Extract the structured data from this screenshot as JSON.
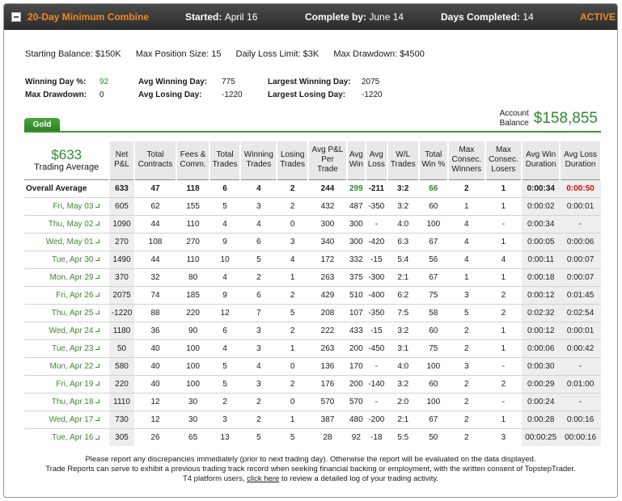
{
  "header": {
    "combine_name": "20-Day Minimum Combine",
    "started_label": "Started:",
    "started_value": "April 16",
    "complete_label": "Complete by:",
    "complete_value": "June 14",
    "days_label": "Days Completed:",
    "days_value": "14",
    "status": "ACTIVE"
  },
  "summary": {
    "starting_balance": "Starting Balance: $150K",
    "max_position": "Max Position Size: 15",
    "daily_loss": "Daily Loss Limit: $3K",
    "max_drawdown": "Max Drawdown: $4500"
  },
  "stats": {
    "winning_day_pct_label": "Winning Day %:",
    "winning_day_pct_value": "92",
    "max_drawdown_label": "Max Drawdown:",
    "max_drawdown_value": "0",
    "avg_winning_day_label": "Avg Winning Day:",
    "avg_winning_day_value": "775",
    "avg_losing_day_label": "Avg Losing Day:",
    "avg_losing_day_value": "-1220",
    "largest_winning_day_label": "Largest Winning Day:",
    "largest_winning_day_value": "2075",
    "largest_losing_day_label": "Largest Losing Day:",
    "largest_losing_day_value": "-1220"
  },
  "tab_label": "Gold",
  "account": {
    "label_line1": "Account",
    "label_line2": "Balance",
    "value": "$158,855"
  },
  "table": {
    "avg_trade_value": "$633",
    "avg_trade_label": "Trading Average",
    "headers": [
      [
        "Net",
        "P&L"
      ],
      [
        "Total",
        "Contracts"
      ],
      [
        "Fees &",
        "Comm."
      ],
      [
        "Total",
        "Trades"
      ],
      [
        "Winning",
        "Trades"
      ],
      [
        "Losing",
        "Trades"
      ],
      [
        "Avg P&L",
        "Per",
        "Trade"
      ],
      [
        "Avg",
        "Win"
      ],
      [
        "Avg",
        "Loss"
      ],
      [
        "W/L",
        "Trades"
      ],
      [
        "Total",
        "Win %"
      ],
      [
        "Max",
        "Consec.",
        "Winners"
      ],
      [
        "Max",
        "Consec.",
        "Losers"
      ],
      [
        "Avg Win",
        "Duration"
      ],
      [
        "Avg Loss",
        "Duration"
      ]
    ],
    "overall": [
      "Overall Average",
      "633",
      "47",
      "118",
      "6",
      "4",
      "2",
      "244",
      "299",
      "-211",
      "3:2",
      "66",
      "2",
      "1",
      "0:00:34",
      "0:00:50"
    ],
    "rows": [
      [
        "Fri, May 03",
        "605",
        "62",
        "155",
        "5",
        "3",
        "2",
        "432",
        "487",
        "-350",
        "3:2",
        "60",
        "1",
        "1",
        "0:00:02",
        "0:00:01"
      ],
      [
        "Thu, May 02",
        "1090",
        "44",
        "110",
        "4",
        "4",
        "0",
        "300",
        "300",
        "-",
        "4:0",
        "100",
        "4",
        "-",
        "0:00:34",
        "-"
      ],
      [
        "Wed, May 01",
        "270",
        "108",
        "270",
        "9",
        "6",
        "3",
        "340",
        "300",
        "-420",
        "6:3",
        "67",
        "4",
        "1",
        "0:00:05",
        "0:00:06"
      ],
      [
        "Tue, Apr 30",
        "1490",
        "44",
        "110",
        "10",
        "5",
        "4",
        "172",
        "332",
        "-15",
        "5:4",
        "56",
        "4",
        "4",
        "0:00:11",
        "0:00:07"
      ],
      [
        "Mon, Apr 29",
        "370",
        "32",
        "80",
        "4",
        "2",
        "1",
        "263",
        "375",
        "-300",
        "2:1",
        "67",
        "1",
        "1",
        "0:00:18",
        "0:00:07"
      ],
      [
        "Fri, Apr 26",
        "2075",
        "74",
        "185",
        "9",
        "6",
        "2",
        "429",
        "510",
        "-400",
        "6:2",
        "75",
        "3",
        "2",
        "0:00:12",
        "0:01:45"
      ],
      [
        "Thu, Apr 25",
        "-1220",
        "88",
        "220",
        "12",
        "7",
        "5",
        "208",
        "107",
        "-350",
        "7:5",
        "58",
        "5",
        "2",
        "0:02:32",
        "0:02:54"
      ],
      [
        "Wed, Apr 24",
        "1180",
        "36",
        "90",
        "6",
        "3",
        "2",
        "222",
        "433",
        "-15",
        "3:2",
        "60",
        "2",
        "1",
        "0:00:12",
        "0:00:01"
      ],
      [
        "Tue, Apr 23",
        "50",
        "40",
        "100",
        "4",
        "3",
        "1",
        "263",
        "200",
        "-450",
        "3:1",
        "75",
        "2",
        "1",
        "0:00:06",
        "0:00:42"
      ],
      [
        "Mon, Apr 22",
        "580",
        "40",
        "100",
        "5",
        "4",
        "0",
        "136",
        "170",
        "-",
        "4:0",
        "100",
        "3",
        "-",
        "0:00:30",
        "-"
      ],
      [
        "Fri, Apr 19",
        "220",
        "40",
        "100",
        "5",
        "3",
        "2",
        "176",
        "200",
        "-140",
        "3:2",
        "60",
        "2",
        "2",
        "0:00:29",
        "0:01:00"
      ],
      [
        "Thu, Apr 18",
        "1110",
        "12",
        "30",
        "2",
        "2",
        "0",
        "570",
        "570",
        "-",
        "2:0",
        "100",
        "2",
        "-",
        "0:00:24",
        "-"
      ],
      [
        "Wed, Apr 17",
        "730",
        "12",
        "30",
        "3",
        "2",
        "1",
        "387",
        "480",
        "-200",
        "2:1",
        "67",
        "2",
        "1",
        "0:00:28",
        "0:00:16"
      ],
      [
        "Tue, Apr 16",
        "305",
        "26",
        "65",
        "13",
        "5",
        "5",
        "28",
        "92",
        "-18",
        "5:5",
        "50",
        "2",
        "3",
        "00:00:25",
        "00:00:16"
      ]
    ]
  },
  "footer": {
    "line1": "Please report any discrepancies immediately (prior to next trading day). Otherwise the report will be evaluated on the data displayed.",
    "line2": "Trade Reports can serve to exhibit a previous trading track record when seeking financial backing or employment, with the written consent of TopstepTrader.",
    "line3_prefix": "T4 platform users,",
    "link": "click here",
    "line3_suffix": "to review a detailed log of your trading activity."
  },
  "colors": {
    "accent_orange": "#f08a24",
    "green": "#2e8b2e",
    "red": "#cc1111"
  }
}
